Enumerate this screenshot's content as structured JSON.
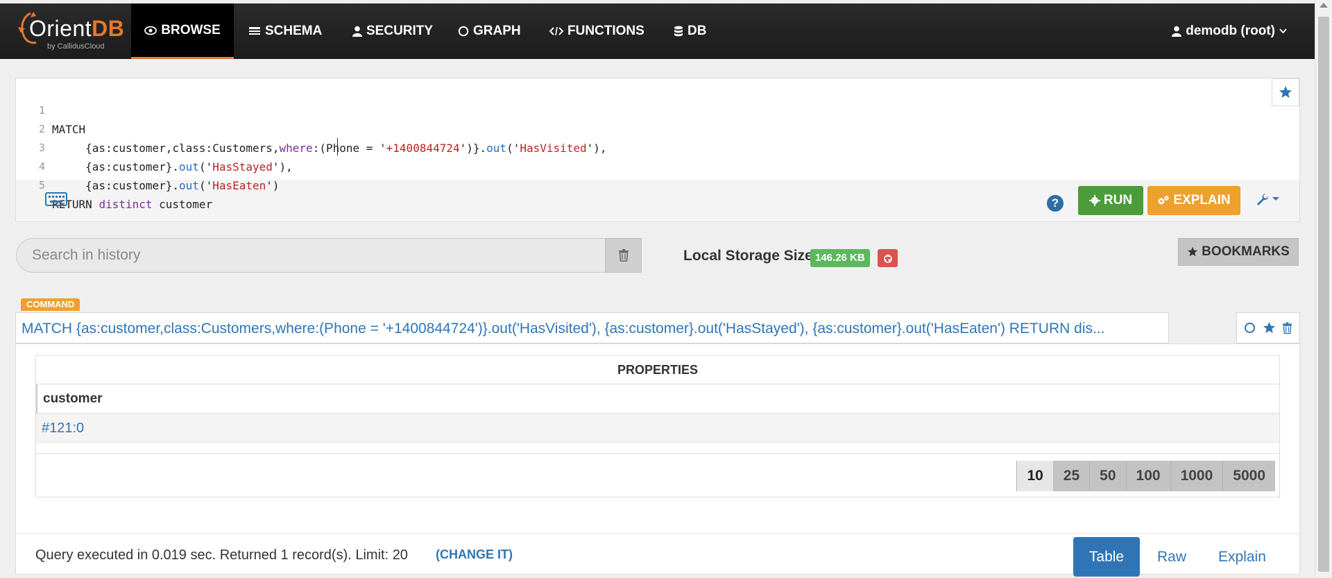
{
  "navbar": {
    "logo_text_1": "Orient",
    "logo_text_2": "DB",
    "logo_sub": "by CallidusCloud",
    "items": [
      {
        "label": "BROWSE",
        "icon": "eye-icon"
      },
      {
        "label": "SCHEMA",
        "icon": "table-icon"
      },
      {
        "label": "SECURITY",
        "icon": "user-icon"
      },
      {
        "label": "GRAPH",
        "icon": "circle-icon"
      },
      {
        "label": "FUNCTIONS",
        "icon": "code-icon"
      },
      {
        "label": "DB",
        "icon": "database-icon"
      }
    ],
    "user": "demodb (root)"
  },
  "editor": {
    "line_numbers": [
      "1",
      "2",
      "3",
      "4",
      "5"
    ]
  },
  "toolbar": {
    "run_label": "RUN",
    "explain_label": "EXPLAIN",
    "help_label": "?"
  },
  "history": {
    "search_placeholder": "Search in history",
    "local_storage_label": "Local Storage Size",
    "local_storage_size": "146.26 KB",
    "bookmarks_label": "BOOKMARKS"
  },
  "command": {
    "label": "COMMAND",
    "query": "MATCH {as:customer,class:Customers,where:(Phone = '+1400844724')}.out('HasVisited'), {as:customer}.out('HasStayed'), {as:customer}.out('HasEaten') RETURN dis..."
  },
  "result": {
    "properties_header": "PROPERTIES",
    "column": "customer",
    "rows": [
      "#121:0"
    ],
    "page_sizes": [
      "10",
      "25",
      "50",
      "100",
      "1000",
      "5000"
    ],
    "active_page_size": "10"
  },
  "footer": {
    "status": "Query executed in 0.019 sec. Returned 1 record(s). Limit: 20",
    "change_label": "(CHANGE IT)",
    "tabs": [
      "Table",
      "Raw",
      "Explain"
    ],
    "active_tab": "Table"
  },
  "colors": {
    "accent_orange": "#efa02d",
    "run_green": "#4a9d3a",
    "link_blue": "#2f75b5",
    "badge_green": "#5cb85c",
    "danger_red": "#d9534f"
  }
}
